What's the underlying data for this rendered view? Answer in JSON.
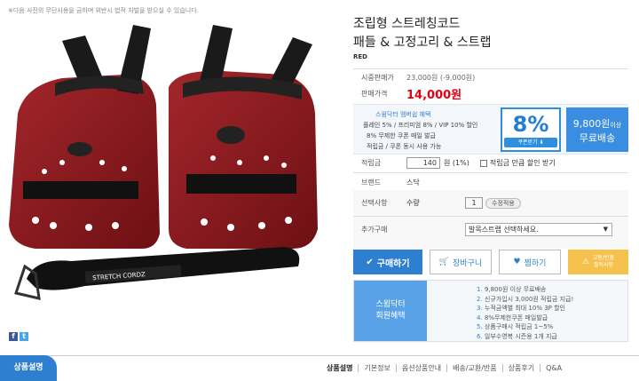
{
  "notice": "※다음 사진의 무단사용을 금하며 위반시 법적 처벌을 받으실 수 있습니다.",
  "product": {
    "title_line1": "조립형 스트레칭코드",
    "title_line2": "패들 & 고정고리 & 스트랩",
    "color": "RED",
    "strap_print": "STRETCH CORDZ"
  },
  "prices": {
    "market_label": "시중판매가",
    "market_value": "23,000원 (-9,000원)",
    "sale_label": "판매가격",
    "sale_value": "14,000원"
  },
  "benefit": {
    "heading": "스윔닥터 멤버쉽 혜택",
    "line1": "플레인 5% / 프리미엄 8% / VIP 10% 할인",
    "line2": "8% 무제한 쿠폰 매일 발급",
    "line3": "적립금 / 쿠폰 동시 사용 가능",
    "coupon_pct": "8%",
    "coupon_btn": "쿠폰받기 ⬇",
    "free_amount": "9,800원",
    "free_suffix": "이상",
    "free_label": "무료배송"
  },
  "points": {
    "label": "적립금",
    "value": "140",
    "unit": "원 (1%)",
    "checkbox_label": "적립금 만큼 할인 받기"
  },
  "brand": {
    "label": "브랜드",
    "value": "스닥"
  },
  "options": {
    "label": "선택사항",
    "qty_label": "수량",
    "qty_value": "1",
    "qty_btn": "수정적용",
    "extra_label": "추가구매",
    "extra_value": "발목스트랩 선택하세요."
  },
  "buttons": {
    "buy": "구매하기",
    "cart": "장바구니",
    "wish": "찜하기",
    "exchange1": "교환/반품",
    "exchange2": "필독사항"
  },
  "member": {
    "side1": "스윔닥터",
    "side2": "회원혜택",
    "items": [
      "9,800원 이상 무료배송",
      "신규가입시 3,000원 적립금 지급!",
      "누적금액별 최대 10% 3P 할인",
      "8%무제한쿠폰 매일발급",
      "상품구매시 적립금 1~5%",
      "일부수영복 시즌용 1개 지급"
    ]
  },
  "tabs": {
    "active": "상품설명",
    "items": [
      "상품설명",
      "기본정보",
      "옵션상품안내",
      "배송/교환/반품",
      "상품후기",
      "Q&A"
    ]
  },
  "colors": {
    "accent": "#2f7fd1",
    "sale": "#e60012",
    "paddle": "#8b1a1f"
  }
}
